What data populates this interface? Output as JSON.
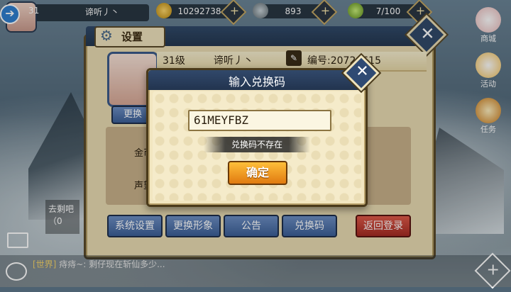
{
  "top_bar": {
    "player_level": "31",
    "player_name": "谛听丿丶",
    "resources": [
      {
        "icon": "coin-icon",
        "value": "10292738"
      },
      {
        "icon": "horn-icon",
        "value": "893"
      },
      {
        "icon": "stamina-icon",
        "value": "7/100"
      }
    ]
  },
  "side_menu": [
    {
      "icon": "shop-icon",
      "label": "商城"
    },
    {
      "icon": "event-icon",
      "label": "活动"
    },
    {
      "icon": "task-icon",
      "label": "任务"
    }
  ],
  "settings": {
    "title": "设置",
    "level_label": "31级",
    "name": "谛听丿丶",
    "id_label": "编号:20724615",
    "change_avatar_label": "更换",
    "stats": [
      {
        "label": "金币:"
      },
      {
        "label": "声望:"
      }
    ],
    "buttons": [
      "系统设置",
      "更换形象",
      "公告",
      "兑换码"
    ],
    "logout_label": "返回登录"
  },
  "chat": {
    "channel": "[世界]",
    "message": "痔痔~: 剩仔现在斩仙多少...",
    "side_preview": "去剩吧（0"
  },
  "dialog": {
    "title": "输入兑换码",
    "code_value": "61MEYFBZ",
    "error_text": "兑换码不存在",
    "confirm_label": "确定"
  },
  "colors": {
    "header_blue": "#2c4262",
    "panel_beige": "#efe3bd",
    "confirm_orange": "#f0931f",
    "logout_red": "#c73a30"
  }
}
